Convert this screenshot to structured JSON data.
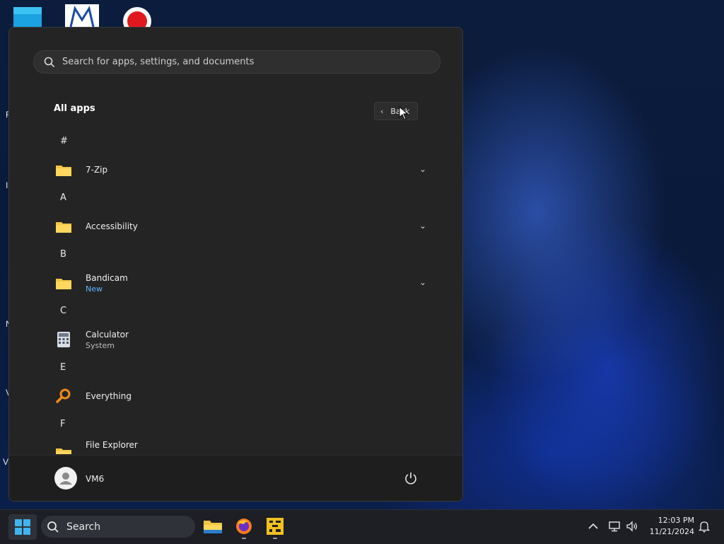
{
  "start_menu": {
    "search_placeholder": "Search for apps, settings, and documents",
    "section_title": "All apps",
    "back_label": "Back",
    "groups": [
      {
        "letter": "#",
        "apps": [
          {
            "name": "7-Zip",
            "sub": "",
            "expandable": true,
            "icon": "folder-icon"
          }
        ]
      },
      {
        "letter": "A",
        "apps": [
          {
            "name": "Accessibility",
            "sub": "",
            "expandable": true,
            "icon": "folder-icon"
          }
        ]
      },
      {
        "letter": "B",
        "apps": [
          {
            "name": "Bandicam",
            "sub": "New",
            "expandable": true,
            "icon": "folder-icon"
          }
        ]
      },
      {
        "letter": "C",
        "apps": [
          {
            "name": "Calculator",
            "sub": "System",
            "expandable": false,
            "icon": "calculator-icon"
          }
        ]
      },
      {
        "letter": "E",
        "apps": [
          {
            "name": "Everything",
            "sub": "",
            "expandable": false,
            "icon": "everything-search-icon"
          }
        ]
      },
      {
        "letter": "F",
        "apps": [
          {
            "name": "File Explorer",
            "sub": "",
            "expandable": false,
            "icon": "folder-icon"
          }
        ]
      }
    ],
    "user": {
      "name": "VM6"
    }
  },
  "taskbar": {
    "search_label": "Search",
    "clock": {
      "time": "12:03 PM",
      "date": "11/21/2024"
    }
  },
  "desktop": {
    "edge_letters": [
      "F",
      "I",
      "N",
      "V",
      "V"
    ]
  },
  "colors": {
    "menu_bg": "#242424",
    "accent_new": "#5cb6ff",
    "taskbar_bg": "#1d1f24"
  }
}
